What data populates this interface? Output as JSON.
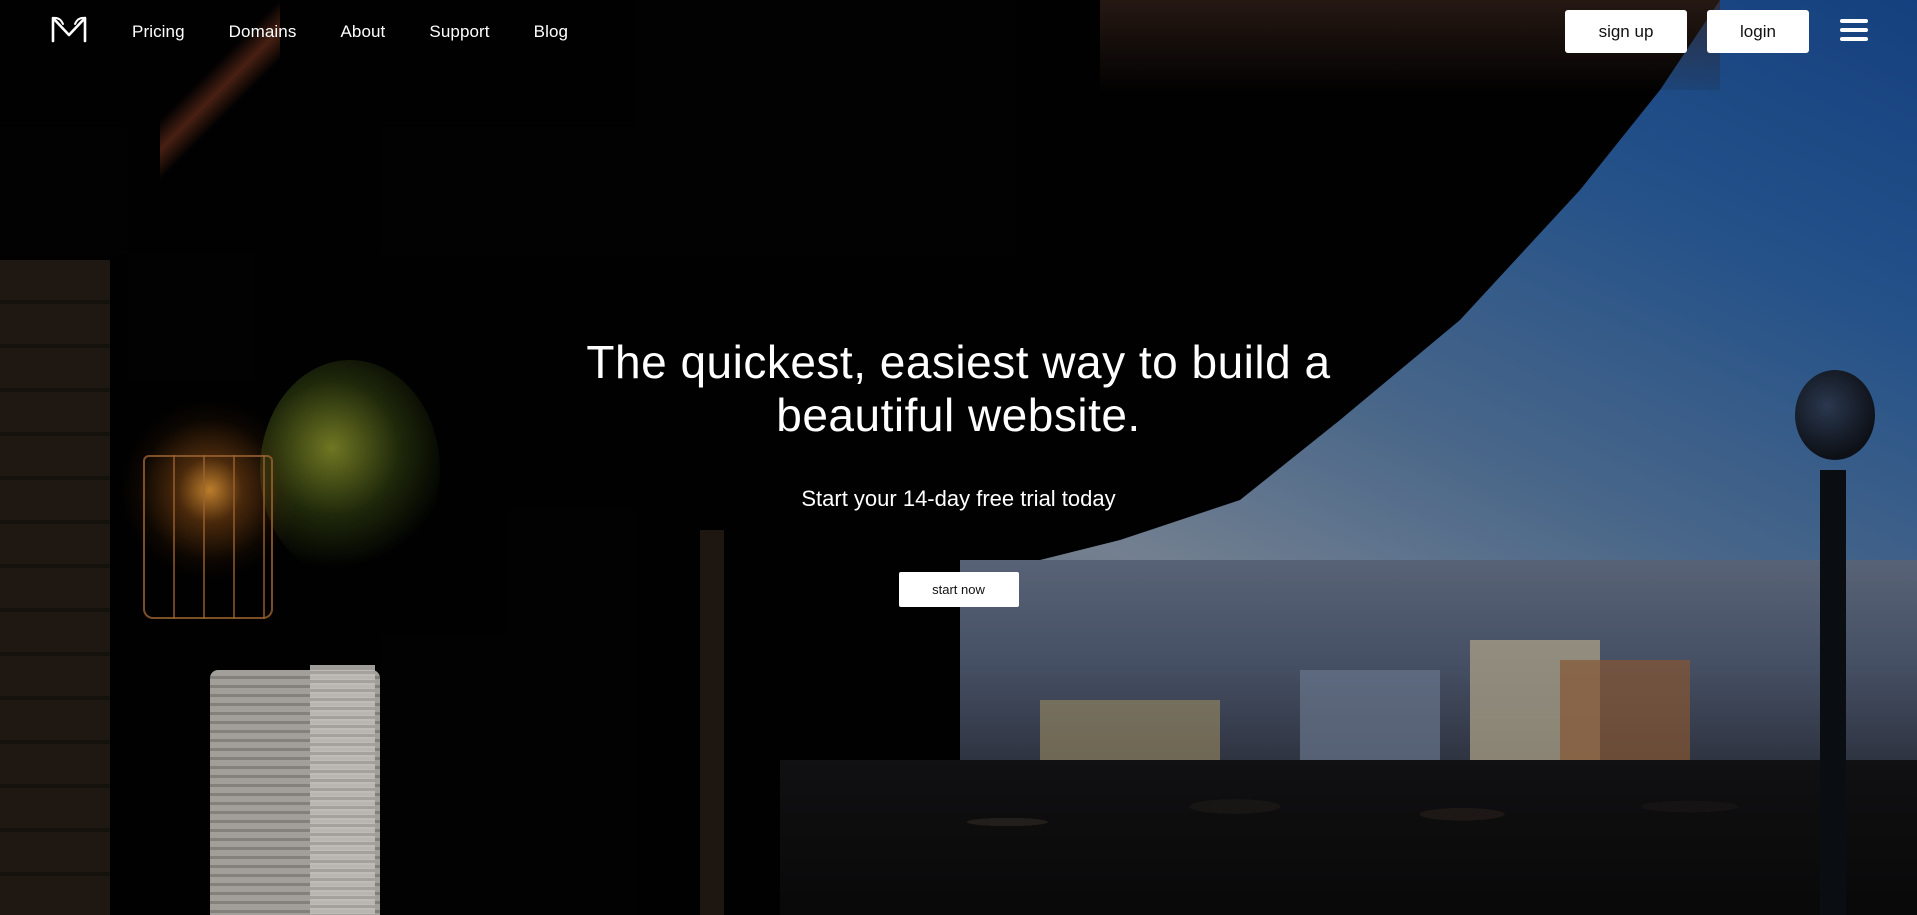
{
  "brand": {
    "logo_icon": "m-logo-icon"
  },
  "nav": {
    "links": [
      {
        "label": "Pricing"
      },
      {
        "label": "Domains"
      },
      {
        "label": "About"
      },
      {
        "label": "Support"
      },
      {
        "label": "Blog"
      }
    ],
    "signup_label": "sign up",
    "login_label": "login",
    "menu_icon": "hamburger-menu-icon"
  },
  "hero": {
    "title": "The quickest, easiest way to build a beautiful website.",
    "subtitle": "Start your 14-day free trial today",
    "cta_label": "start now"
  },
  "colors": {
    "text": "#ffffff",
    "button_bg": "#ffffff",
    "button_text": "#111111",
    "background": "#000000"
  }
}
